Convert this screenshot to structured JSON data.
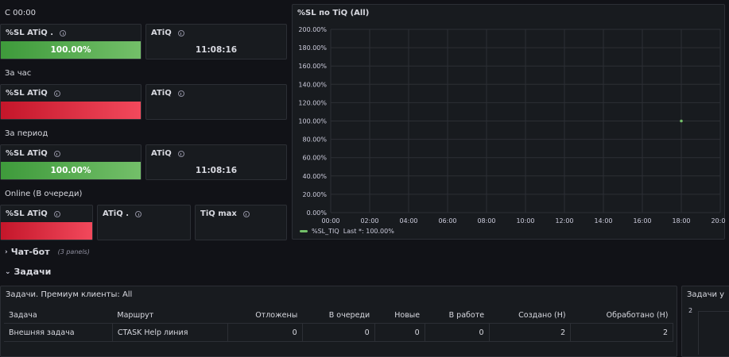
{
  "rows": {
    "r1": "С 00:00",
    "r2": "За час",
    "r3": "За период",
    "r4": "Online (В очереди)"
  },
  "stats": {
    "p1": {
      "title": "%SL ATiQ .",
      "value": "100.00%"
    },
    "p2": {
      "title": "ATiQ",
      "value": "11:08:16"
    },
    "p3": {
      "title": "%SL ATiQ",
      "value": ""
    },
    "p4": {
      "title": "ATiQ",
      "value": ""
    },
    "p5": {
      "title": "%SL ATiQ",
      "value": "100.00%"
    },
    "p6": {
      "title": "ATiQ",
      "value": "11:08:16"
    },
    "p7": {
      "title": "%SL ATiQ",
      "value": ""
    },
    "p8": {
      "title": "ATiQ .",
      "value": ""
    },
    "p9": {
      "title": "TiQ max",
      "value": ""
    }
  },
  "chart_panel": {
    "title": "%SL по TiQ (All)"
  },
  "chart_data": {
    "type": "line",
    "title": "%SL по TiQ (All)",
    "xlabel": "",
    "ylabel": "",
    "x_ticks": [
      "00:00",
      "02:00",
      "04:00",
      "06:00",
      "08:00",
      "10:00",
      "12:00",
      "14:00",
      "16:00",
      "18:00",
      "20:00"
    ],
    "y_ticks": [
      "0.00%",
      "20.00%",
      "40.00%",
      "60.00%",
      "80.00%",
      "100.00%",
      "120.00%",
      "140.00%",
      "160.00%",
      "180.00%",
      "200.00%"
    ],
    "ylim": [
      0,
      200
    ],
    "xlim_hours": [
      0,
      20
    ],
    "grid": true,
    "legend_position": "bottom-left",
    "series": [
      {
        "name": "%SL_TIQ",
        "color": "#73bf69",
        "points": [
          {
            "x_hours": 18,
            "y": 100
          }
        ]
      }
    ],
    "legend_text": "%SL_TIQ",
    "legend_last": "Last *: 100.00%"
  },
  "chatbot": {
    "title": "Чат-бот",
    "sub": "(3 panels)"
  },
  "tasks_row": {
    "title": "Задачи"
  },
  "table_panel": {
    "title": "Задачи. Премиум клиенты: All",
    "columns": [
      "Задача",
      "Маршрут",
      "Отложены",
      "В очереди",
      "Новые",
      "В работе",
      "Создано (Н)",
      "Обработано (Н)"
    ],
    "rows": [
      [
        "Внешняя задача",
        "CTASK Help линия",
        "0",
        "0",
        "0",
        "0",
        "2",
        "2"
      ]
    ]
  },
  "right_panel": {
    "title": "Задачи у",
    "tick": "2"
  },
  "colors": {
    "green": "#73bf69",
    "red": "#f2495c",
    "bg": "#111217",
    "panel": "#181b1f"
  }
}
